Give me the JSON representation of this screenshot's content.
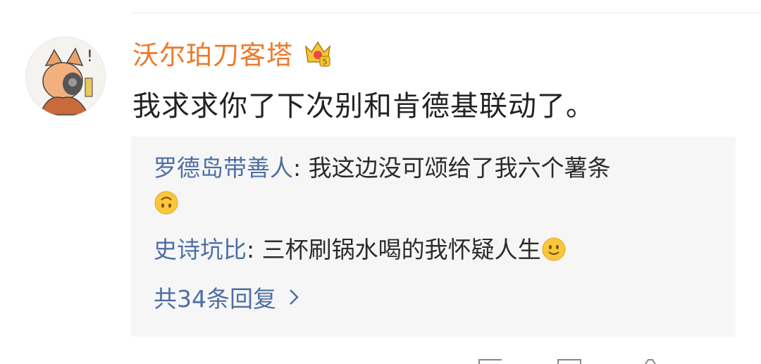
{
  "comment": {
    "username": "沃尔珀刀客塔",
    "text": "我求求你了下次别和肯德基联动了。"
  },
  "replies": [
    {
      "author": "罗德岛带善人",
      "separator": ": ",
      "text": "我这边没可颂给了我六个薯条",
      "emoji": "upside-down-face-emoji"
    },
    {
      "author": "史诗坑比",
      "separator": ": ",
      "text": "三杯刷锅水喝的我怀疑人生",
      "emoji": "slight-smile-emoji"
    }
  ],
  "more_replies": {
    "label": "共34条回复",
    "icon": "chevron-right-icon"
  },
  "colors": {
    "username": "#eb7a2c",
    "link": "#4e6fa3",
    "reply_bg": "#f6f6f6"
  }
}
